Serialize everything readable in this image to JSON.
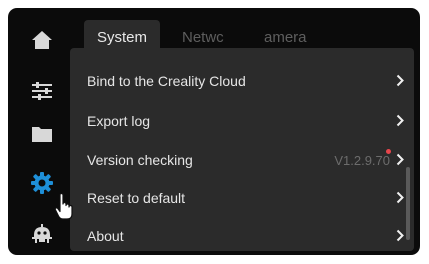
{
  "sidebar": {
    "items": [
      {
        "icon": "home-icon",
        "active": false
      },
      {
        "icon": "sliders-icon",
        "active": false
      },
      {
        "icon": "folder-icon",
        "active": false
      },
      {
        "icon": "gear-icon",
        "active": true
      },
      {
        "icon": "robot-icon",
        "active": false
      }
    ]
  },
  "tabs": [
    {
      "label": "System",
      "active": true
    },
    {
      "label": "Netwc",
      "active": false
    },
    {
      "label": "amera",
      "active": false
    }
  ],
  "settings": {
    "rows": [
      {
        "label": "Bind to the Creality Cloud"
      },
      {
        "label": "Export log"
      },
      {
        "label": "Version checking",
        "value": "V1.2.9.70",
        "update_badge": true
      },
      {
        "label": "Reset to default"
      },
      {
        "label": "About"
      }
    ]
  },
  "colors": {
    "screen_bg": "#0b0b0b",
    "panel_bg": "#2b2b2b",
    "accent": "#1e8fd8",
    "badge": "#e8464c"
  }
}
